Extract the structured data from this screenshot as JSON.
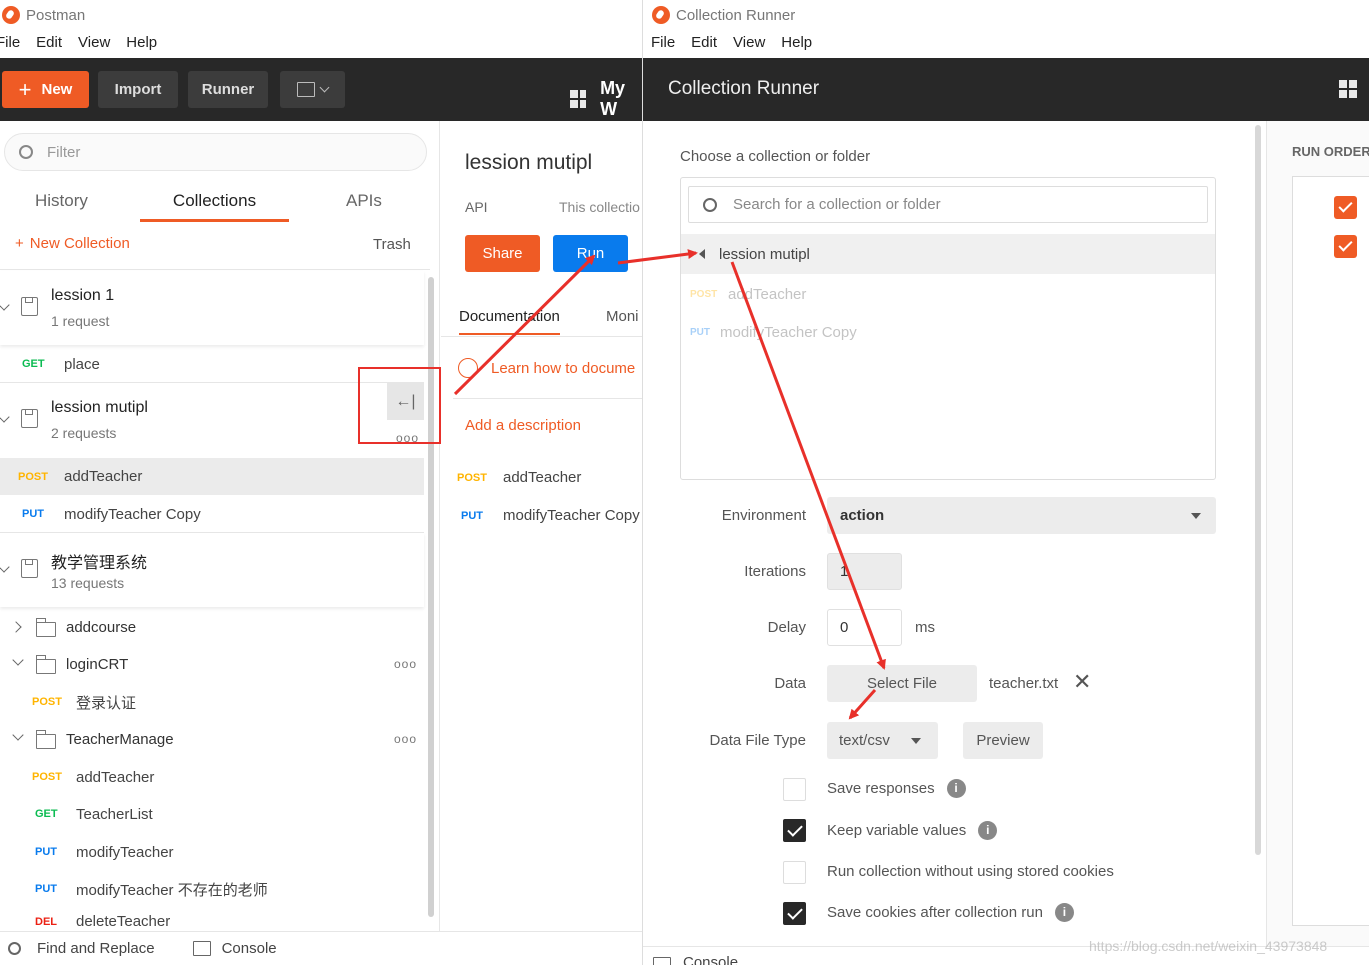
{
  "left_window": {
    "title": "Postman",
    "menu": [
      "File",
      "Edit",
      "View",
      "Help"
    ],
    "toolbar": {
      "new_label": "New",
      "import_label": "Import",
      "runner_label": "Runner",
      "workspace_label": "My W"
    },
    "filter_placeholder": "Filter",
    "tabs": [
      "History",
      "Collections",
      "APIs"
    ],
    "new_collection_label": "New Collection",
    "trash_label": "Trash",
    "sidebar": {
      "c1": {
        "name": "lession 1",
        "count": "1 request"
      },
      "c1_req": {
        "method": "GET",
        "name": "place"
      },
      "c2": {
        "name": "lession mutipl",
        "count": "2 requests"
      },
      "c2_req1": {
        "method": "POST",
        "name": "addTeacher"
      },
      "c2_req2": {
        "method": "PUT",
        "name": "modifyTeacher Copy"
      },
      "c3": {
        "name": "教学管理系统",
        "count": "13 requests"
      },
      "f1": "addcourse",
      "f2": "loginCRT",
      "f2_req": {
        "method": "POST",
        "name": "登录认证"
      },
      "f3": "TeacherManage",
      "f3_reqs": [
        {
          "method": "POST",
          "name": "addTeacher"
        },
        {
          "method": "GET",
          "name": "TeacherList"
        },
        {
          "method": "PUT",
          "name": "modifyTeacher"
        },
        {
          "method": "PUT",
          "name": "modifyTeacher 不存在的老师"
        },
        {
          "method": "DEL",
          "name": "deleteTeacher"
        }
      ]
    },
    "detail": {
      "title": "lession mutipl",
      "api_label": "API",
      "desc_snippet": "This collectio",
      "share_label": "Share",
      "run_label": "Run",
      "tab_doc": "Documentation",
      "tab_mon": "Moni",
      "learn_link": "Learn how to docume",
      "add_desc": "Add a description",
      "reqs": [
        {
          "method": "POST",
          "name": "addTeacher"
        },
        {
          "method": "PUT",
          "name": "modifyTeacher Copy"
        }
      ]
    },
    "footer": {
      "find_label": "Find and Replace",
      "console_label": "Console"
    }
  },
  "runner_window": {
    "title": "Collection Runner",
    "menu": [
      "File",
      "Edit",
      "View",
      "Help"
    ],
    "header_title": "Collection Runner",
    "choose_label": "Choose a collection or folder",
    "search_placeholder": "Search for a collection or folder",
    "selected_collection": "lession mutipl",
    "list_items": [
      {
        "method": "POST",
        "name": "addTeacher"
      },
      {
        "method": "PUT",
        "name": "modifyTeacher Copy"
      }
    ],
    "environment": {
      "label": "Environment",
      "value": "action"
    },
    "iterations": {
      "label": "Iterations",
      "value": "1"
    },
    "delay": {
      "label": "Delay",
      "value": "0",
      "unit": "ms"
    },
    "data": {
      "label": "Data",
      "button": "Select File",
      "file": "teacher.txt"
    },
    "data_file_type": {
      "label": "Data File Type",
      "value": "text/csv",
      "preview": "Preview"
    },
    "options": [
      {
        "label": "Save responses",
        "checked": false,
        "info": true
      },
      {
        "label": "Keep variable values",
        "checked": true,
        "info": true
      },
      {
        "label": "Run collection without using stored cookies",
        "checked": false,
        "info": false
      },
      {
        "label": "Save cookies after collection run",
        "checked": true,
        "info": true
      }
    ],
    "run_order_label": "RUN ORDER",
    "console_label": "Console",
    "watermark": "https://blog.csdn.net/weixin_43973848"
  },
  "colors": {
    "accent": "#ef5b25",
    "dark": "#282828",
    "annotation": "#e8302a",
    "run_blue": "#097bed"
  }
}
